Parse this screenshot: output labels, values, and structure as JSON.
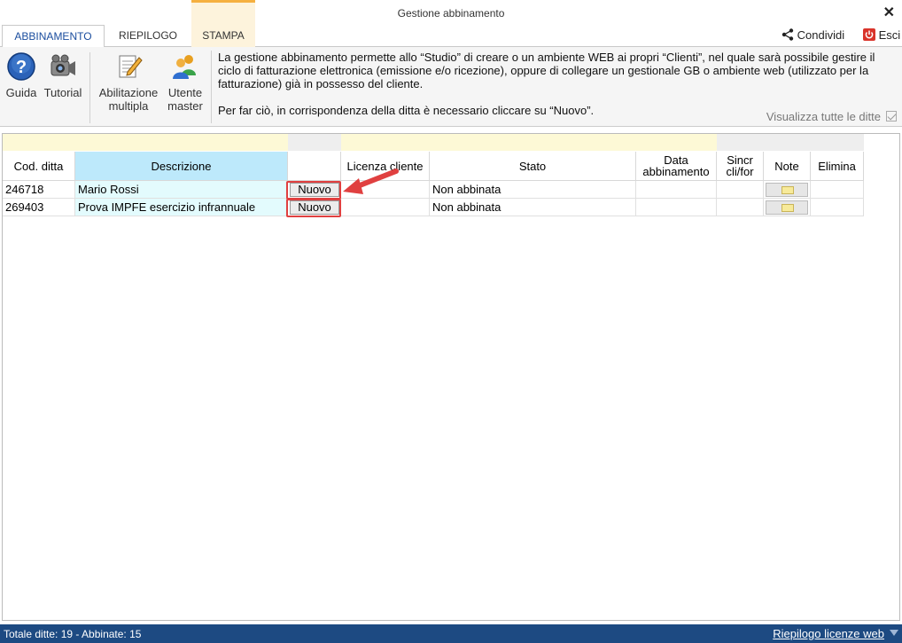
{
  "window": {
    "title": "Gestione abbinamento"
  },
  "tabs": [
    {
      "label": "ABBINAMENTO"
    },
    {
      "label": "RIEPILOGO"
    },
    {
      "label": "STAMPA"
    }
  ],
  "header_actions": {
    "share_label": "Condividi",
    "exit_label": "Esci"
  },
  "ribbon": {
    "buttons": [
      {
        "label": "Guida",
        "icon": "help-icon"
      },
      {
        "label": "Tutorial",
        "icon": "camera-icon"
      },
      {
        "label_line1": "Abilitazione",
        "label_line2": "multipla",
        "icon": "edit-document-icon"
      },
      {
        "label_line1": "Utente",
        "label_line2": "master",
        "icon": "users-icon"
      }
    ],
    "info_p1": "La gestione abbinamento permette allo “Studio” di creare o un ambiente WEB ai propri “Clienti”, nel quale sarà possibile gestire il ciclo di fatturazione elettronica (emissione e/o ricezione), oppure di collegare un gestionale GB o ambiente web (utilizzato per la fatturazione) già in possesso del cliente.",
    "info_p2": "Per far ciò, in corrispondenza della ditta è necessario cliccare su “Nuovo”.",
    "visualizza_label": "Visualizza tutte le ditte"
  },
  "grid": {
    "headers": {
      "cod": "Cod. ditta",
      "descrizione": "Descrizione",
      "azione": "",
      "licenza": "Licenza cliente",
      "stato": "Stato",
      "data_l1": "Data",
      "data_l2": "abbinamento",
      "sincr_l1": "Sincr",
      "sincr_l2": "cli/for",
      "note": "Note",
      "elimina": "Elimina"
    },
    "rows": [
      {
        "cod": "246718",
        "descrizione": "Mario Rossi",
        "azione": "Nuovo",
        "licenza": "",
        "stato": "Non abbinata",
        "data": "",
        "sincr": ""
      },
      {
        "cod": "269403",
        "descrizione": "Prova IMPFE esercizio infrannuale",
        "azione": "Nuovo",
        "licenza": "",
        "stato": "Non abbinata",
        "data": "",
        "sincr": ""
      }
    ]
  },
  "statusbar": {
    "summary": "Totale ditte: 19 - Abbinate: 15",
    "link": "Riepilogo licenze web"
  },
  "colors": {
    "accent": "#1a4d9e",
    "statusbar": "#1d4a82",
    "highlight": "#e04040",
    "header_blue": "#bde9fb",
    "row_cyan": "#e3fbfd"
  }
}
